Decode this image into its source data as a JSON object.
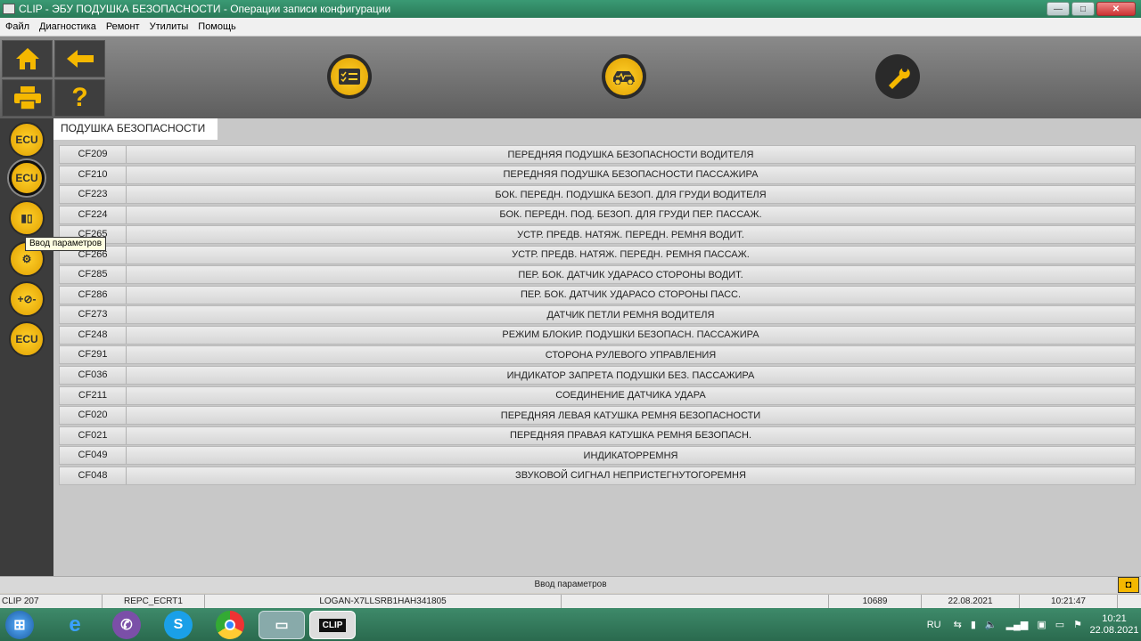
{
  "window": {
    "title": "CLIP - ЭБУ ПОДУШКА БЕЗОПАСНОСТИ - Операции записи конфигурации",
    "minimize": "—",
    "maximize": "□",
    "close": "✕"
  },
  "menu": [
    "Файл",
    "Диагностика",
    "Ремонт",
    "Утилиты",
    "Помощь"
  ],
  "toolbar": {
    "home_icon": "home-icon",
    "back_icon": "arrow-left-icon",
    "print_icon": "printer-icon",
    "help_label": "?",
    "big_buttons": [
      "checklist-icon",
      "car-diagnostic-icon",
      "wrench-icon"
    ]
  },
  "sidebar": {
    "items": [
      "ecu-info-icon",
      "ecu-write-icon",
      "parameter-input-icon",
      "engine-icon",
      "plus-minus-icon",
      "ecu-replace-icon"
    ],
    "tooltip": "Ввод параметров"
  },
  "main": {
    "tab_label": "ПОДУШКА БЕЗОПАСНОСТИ",
    "rows": [
      {
        "code": "CF209",
        "desc": "ПЕРЕДНЯЯ ПОДУШКА БЕЗОПАСНОСТИ ВОДИТЕЛЯ"
      },
      {
        "code": "CF210",
        "desc": "ПЕРЕДНЯЯ ПОДУШКА БЕЗОПАСНОСТИ ПАССАЖИРА"
      },
      {
        "code": "CF223",
        "desc": "БОК. ПЕРЕДН. ПОДУШКА БЕЗОП. ДЛЯ ГРУДИ ВОДИТЕЛЯ"
      },
      {
        "code": "CF224",
        "desc": "БОК. ПЕРЕДН. ПОД. БЕЗОП. ДЛЯ ГРУДИ ПЕР. ПАССАЖ."
      },
      {
        "code": "CF265",
        "desc": "УСТР. ПРЕДВ. НАТЯЖ. ПЕРЕДН. РЕМНЯ ВОДИТ."
      },
      {
        "code": "CF266",
        "desc": "УСТР. ПРЕДВ. НАТЯЖ. ПЕРЕДН. РЕМНЯ ПАССАЖ."
      },
      {
        "code": "CF285",
        "desc": "ПЕР. БОК. ДАТЧИК УДАРАСО СТОРОНЫ ВОДИТ."
      },
      {
        "code": "CF286",
        "desc": "ПЕР. БОК. ДАТЧИК УДАРАСО СТОРОНЫ ПАСС."
      },
      {
        "code": "CF273",
        "desc": "ДАТЧИК ПЕТЛИ РЕМНЯ ВОДИТЕЛЯ"
      },
      {
        "code": "CF248",
        "desc": "РЕЖИМ БЛОКИР. ПОДУШКИ БЕЗОПАСН. ПАССАЖИРА"
      },
      {
        "code": "CF291",
        "desc": "СТОРОНА РУЛЕВОГО УПРАВЛЕНИЯ"
      },
      {
        "code": "CF036",
        "desc": "ИНДИКАТОР ЗАПРЕТА ПОДУШКИ БЕЗ. ПАССАЖИРА"
      },
      {
        "code": "CF211",
        "desc": "СОЕДИНЕНИЕ ДАТЧИКА УДАРА"
      },
      {
        "code": "CF020",
        "desc": "ПЕРЕДНЯЯ ЛЕВАЯ КАТУШКА РЕМНЯ БЕЗОПАСНОСТИ"
      },
      {
        "code": "CF021",
        "desc": "ПЕРЕДНЯЯ ПРАВАЯ КАТУШКА РЕМНЯ БЕЗОПАСН."
      },
      {
        "code": "CF049",
        "desc": "ИНДИКАТОРРЕМНЯ"
      },
      {
        "code": "CF048",
        "desc": "ЗВУКОВОЙ СИГНАЛ НЕПРИСТЕГНУТОГОРЕМНЯ"
      }
    ]
  },
  "status": {
    "message": "Ввод параметров",
    "clip": "CLIP 207",
    "repc": "REPC_ECRT1",
    "vehicle": "LOGAN-X7LLSRB1HAH341805",
    "num": "10689",
    "date": "22.08.2021",
    "time": "10:21:47"
  },
  "taskbar": {
    "apps": [
      "windows-start-icon",
      "ie-icon",
      "viber-icon",
      "skype-icon",
      "chrome-icon",
      "clip-app-icon",
      "clip-window-icon"
    ],
    "lang": "RU",
    "clock_time": "10:21",
    "clock_date": "22.08.2021"
  }
}
